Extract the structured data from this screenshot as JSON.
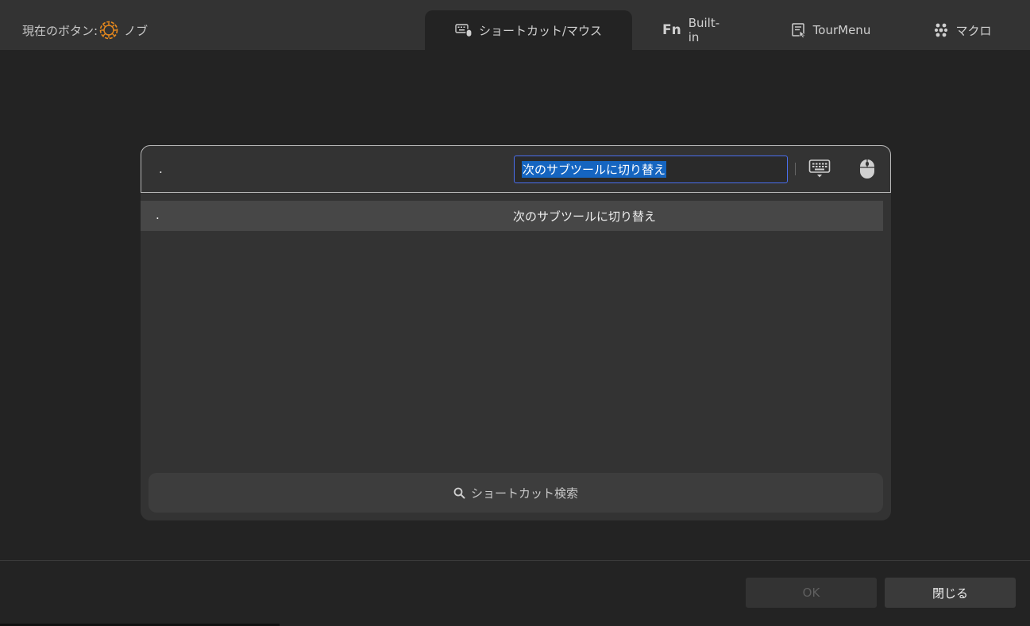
{
  "header": {
    "current_button_label": "現在のボタン:",
    "current_button_value": "ノブ",
    "tabs": [
      {
        "label": "ショートカット/マウス",
        "icon": "keyboard-mouse-icon",
        "active": true
      },
      {
        "label": "Built-in",
        "icon": "fn-icon",
        "active": false
      },
      {
        "label": "TourMenu",
        "icon": "tour-menu-icon",
        "active": false
      },
      {
        "label": "マクロ",
        "icon": "macro-icon",
        "active": false
      }
    ],
    "fn_glyph": "Fn"
  },
  "input": {
    "key_value": ".",
    "name_value": "次のサブツールに切り替え"
  },
  "results": [
    {
      "key": ".",
      "name": "次のサブツールに切り替え"
    }
  ],
  "search": {
    "label": "ショートカット検索"
  },
  "footer": {
    "ok_label": "OK",
    "close_label": "閉じる"
  },
  "colors": {
    "accent_orange": "#e8891c",
    "selection_blue": "#1565c0",
    "field_border": "#4a6ff0"
  }
}
